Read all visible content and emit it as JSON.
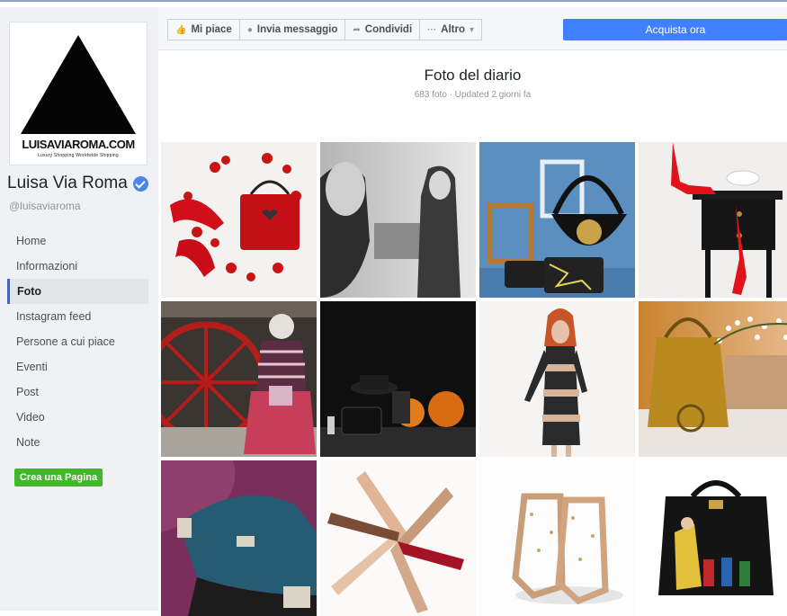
{
  "page": {
    "logo": {
      "wordmark": "LUISAVIAROMA.COM",
      "tagline": "Luxury Shopping Worldwide Shipping"
    },
    "name": "Luisa Via Roma",
    "handle": "@luisaviaroma"
  },
  "nav": {
    "items": [
      "Home",
      "Informazioni",
      "Foto",
      "Instagram feed",
      "Persone a cui piace",
      "Eventi",
      "Post",
      "Video",
      "Note"
    ],
    "active": "Foto"
  },
  "create_page_label": "Crea una Pagina",
  "actions": {
    "like": "Mi piace",
    "message": "Invia messaggio",
    "share": "Condividi",
    "more": "Altro",
    "buy": "Acquista ora"
  },
  "album": {
    "title": "Foto del diario",
    "meta": "683 foto · Updated 2 giorni fa"
  },
  "colors": {
    "accent": "#4267b2",
    "buy_button": "#4080ff",
    "create_button": "#42b72a",
    "sidebar_bg": "#f0f1f4"
  }
}
